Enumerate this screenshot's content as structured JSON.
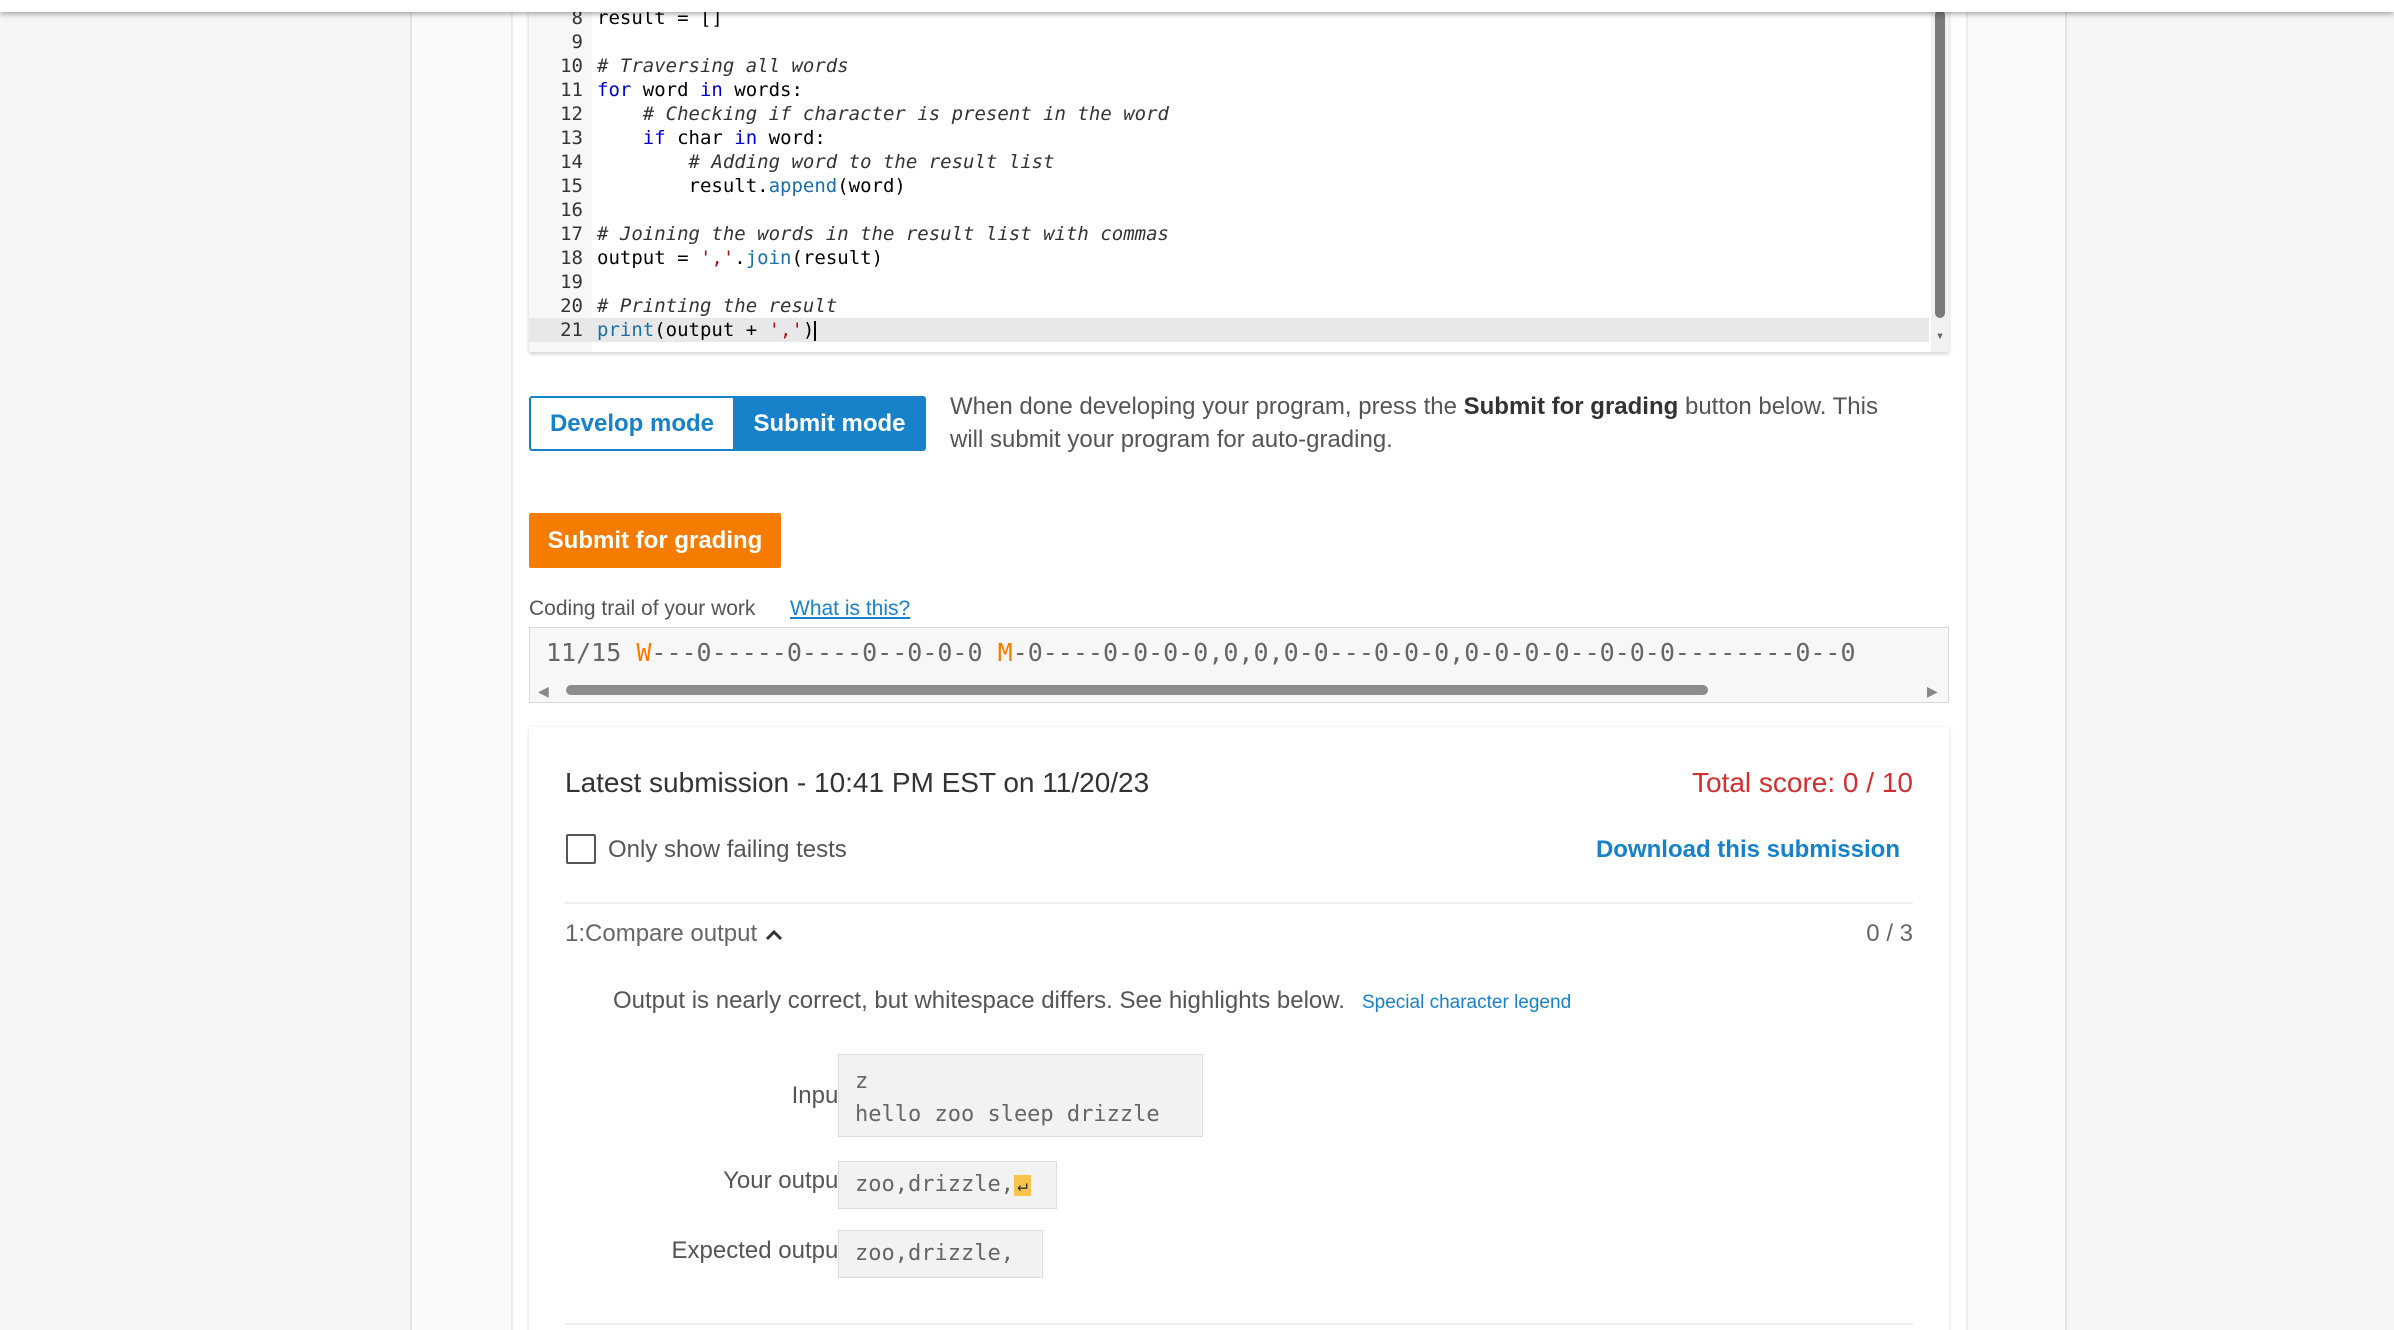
{
  "editor": {
    "lines": [
      {
        "n": "8",
        "parts": [
          {
            "t": "result = []",
            "c": "pl"
          }
        ]
      },
      {
        "n": "9",
        "parts": []
      },
      {
        "n": "10",
        "parts": [
          {
            "t": "# Traversing all words",
            "c": "cm"
          }
        ]
      },
      {
        "n": "11",
        "parts": [
          {
            "t": "for",
            "c": "kw"
          },
          {
            "t": " word ",
            "c": "pl"
          },
          {
            "t": "in",
            "c": "kw"
          },
          {
            "t": " words:",
            "c": "pl"
          }
        ]
      },
      {
        "n": "12",
        "parts": [
          {
            "t": "    # Checking if character is present in the word",
            "c": "cm"
          }
        ]
      },
      {
        "n": "13",
        "parts": [
          {
            "t": "    ",
            "c": "pl"
          },
          {
            "t": "if",
            "c": "kw"
          },
          {
            "t": " char ",
            "c": "pl"
          },
          {
            "t": "in",
            "c": "kw"
          },
          {
            "t": " word:",
            "c": "pl"
          }
        ]
      },
      {
        "n": "14",
        "parts": [
          {
            "t": "        # Adding word to the result list",
            "c": "cm"
          }
        ]
      },
      {
        "n": "15",
        "parts": [
          {
            "t": "        result.",
            "c": "pl"
          },
          {
            "t": "append",
            "c": "fn"
          },
          {
            "t": "(word)",
            "c": "pl"
          }
        ]
      },
      {
        "n": "16",
        "parts": []
      },
      {
        "n": "17",
        "parts": [
          {
            "t": "# Joining the words in the result list with commas",
            "c": "cm"
          }
        ]
      },
      {
        "n": "18",
        "parts": [
          {
            "t": "output = ",
            "c": "pl"
          },
          {
            "t": "','",
            "c": "st"
          },
          {
            "t": ".",
            "c": "pl"
          },
          {
            "t": "join",
            "c": "fn"
          },
          {
            "t": "(result)",
            "c": "pl"
          }
        ]
      },
      {
        "n": "19",
        "parts": []
      },
      {
        "n": "20",
        "parts": [
          {
            "t": "# Printing the result",
            "c": "cm"
          }
        ]
      },
      {
        "n": "21",
        "parts": [
          {
            "t": "print",
            "c": "fn"
          },
          {
            "t": "(output + ",
            "c": "pl"
          },
          {
            "t": "','",
            "c": "st"
          },
          {
            "t": ")",
            "c": "pl"
          }
        ],
        "active": true
      }
    ]
  },
  "mode": {
    "develop_label": "Develop mode",
    "submit_label": "Submit mode",
    "help_prefix": "When done developing your program, press the ",
    "help_bold": "Submit for grading",
    "help_suffix": " button below. This will submit your program for auto-grading."
  },
  "submit_button": "Submit for grading",
  "trail": {
    "label": "Coding trail of your work",
    "link": "What is this?",
    "count": "11/15",
    "w_mark": "W",
    "w_seq": "---0-----0----0--0-0-0",
    "m_mark": "M",
    "m_seq": "-0----0-0-0-0,0,0,0-0---0-0-0,0-0-0-0--0-0-0--------0--0"
  },
  "submission": {
    "title": "Latest submission - 10:41 PM EST on 11/20/23",
    "total_score": "Total score: 0 / 10",
    "only_failing_label": "Only show failing tests",
    "download_label": "Download this submission",
    "test": {
      "title": "1:Compare output",
      "score": "0 / 3",
      "message": "Output is nearly correct, but whitespace differs. See highlights below.",
      "legend_link": "Special character legend",
      "input_label": "Input",
      "input_line1": "z",
      "input_line2": "hello zoo sleep drizzle",
      "your_output_label": "Your output",
      "your_output": "zoo,drizzle,",
      "your_output_ws": "↵",
      "expected_label": "Expected output",
      "expected_output": "zoo,drizzle,"
    }
  },
  "colors": {
    "accent": "#1781c9",
    "submit_orange": "#f57c00",
    "score_red": "#d32f2f",
    "whitespace_highlight": "#f6c44a"
  },
  "icons": {
    "chevron": "chevron-up-icon",
    "checkbox": "checkbox-icon"
  }
}
